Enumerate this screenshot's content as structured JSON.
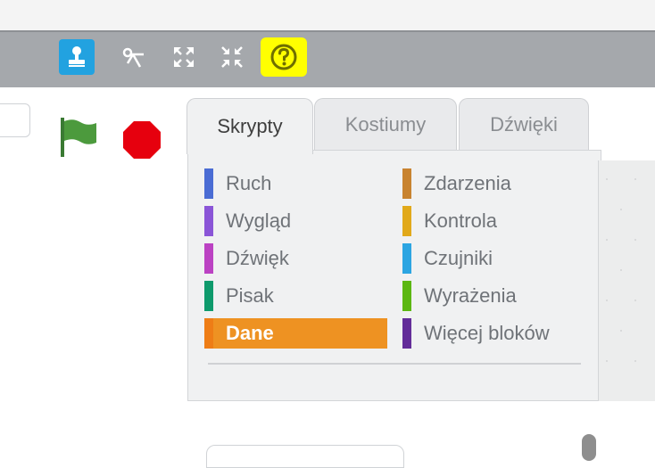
{
  "toolbar": {
    "tools": [
      {
        "icon": "stamp-icon",
        "active": true
      },
      {
        "icon": "scissors-icon",
        "active": false
      },
      {
        "icon": "grow-icon",
        "active": false
      },
      {
        "icon": "shrink-icon",
        "active": false
      },
      {
        "icon": "help-icon",
        "active": false,
        "highlight": "#ffff00"
      }
    ]
  },
  "stage_controls": {
    "green_flag": "green-flag-icon",
    "stop": "stop-icon"
  },
  "tabs": [
    {
      "label": "Skrypty",
      "active": true
    },
    {
      "label": "Kostiumy",
      "active": false
    },
    {
      "label": "Dźwięki",
      "active": false
    }
  ],
  "categories": {
    "left": [
      {
        "label": "Ruch",
        "color": "#4a6cd4"
      },
      {
        "label": "Wygląd",
        "color": "#8a55d7"
      },
      {
        "label": "Dźwięk",
        "color": "#bb42c3"
      },
      {
        "label": "Pisak",
        "color": "#0e9a6c"
      },
      {
        "label": "Dane",
        "color": "#ee7d16",
        "selected": true
      }
    ],
    "right": [
      {
        "label": "Zdarzenia",
        "color": "#c88330"
      },
      {
        "label": "Kontrola",
        "color": "#e1a91a"
      },
      {
        "label": "Czujniki",
        "color": "#2ca5e2"
      },
      {
        "label": "Wyrażenia",
        "color": "#5cb712"
      },
      {
        "label": "Więcej bloków",
        "color": "#632d99"
      }
    ]
  }
}
